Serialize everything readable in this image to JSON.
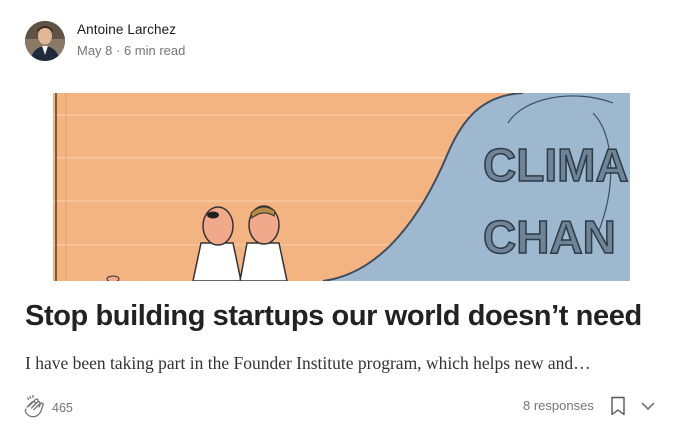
{
  "post": {
    "author": {
      "name": "Antoine Larchez",
      "avatar_icon": "author-avatar"
    },
    "meta": "May 8 · 6 min read",
    "hero": {
      "sign_line1": "CLIMA",
      "sign_line2": "CHAN"
    },
    "title": "Stop building startups our world doesn’t need",
    "excerpt": "I have been taking part in the Founder Institute program, which helps new and…",
    "footer": {
      "clap_icon": "clap-icon",
      "clap_count": "465",
      "responses_label": "8 responses",
      "bookmark_icon": "bookmark-icon",
      "more_icon": "chevron-down-icon"
    }
  },
  "colors": {
    "wall_orange": "#f4b482",
    "wave_blue": "#9db8cf",
    "text_dark": "#222222",
    "text_muted": "#757575"
  }
}
